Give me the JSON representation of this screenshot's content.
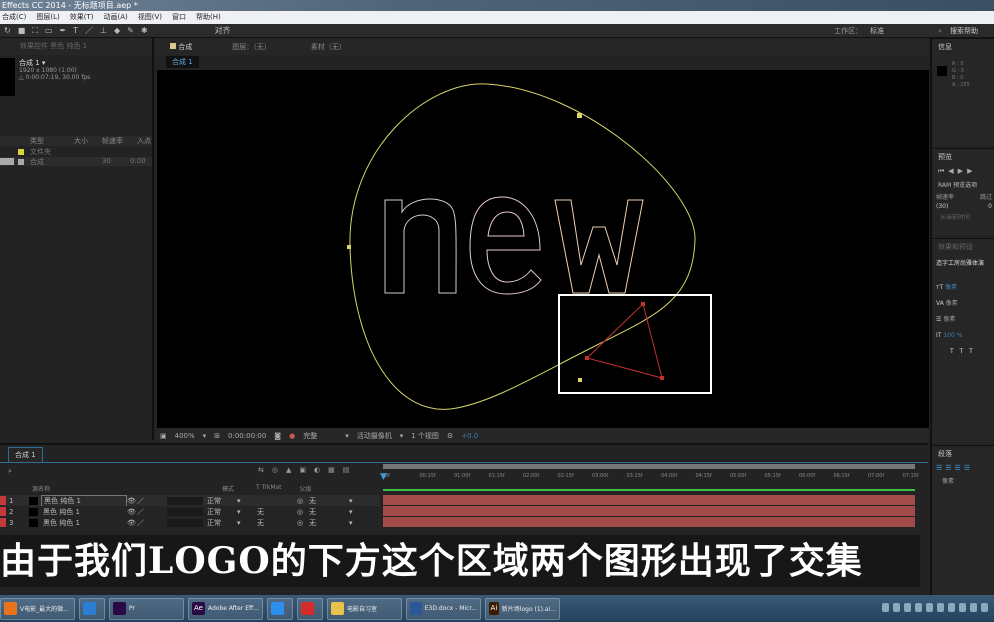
{
  "window": {
    "title": "Effects CC 2014 - 无标题项目.aep *"
  },
  "menu": [
    "合成(C)",
    "图层(L)",
    "效果(T)",
    "动画(A)",
    "视图(V)",
    "窗口",
    "帮助(H)"
  ],
  "toolbar": {
    "snap_label": "对齐",
    "workspace_label": "工作区：",
    "workspace_value": "标准",
    "search_label": "搜索帮助"
  },
  "project": {
    "effects_tab": "效果控件 黑色 纯色 1",
    "comp_name": "合成 1 ▾",
    "comp_size": "1920 x 1080 (1.00)",
    "comp_duration": "△ 0:00:07:19, 30.00 fps",
    "columns": [
      "类型",
      "大小",
      "帧速率",
      "入点"
    ],
    "items": [
      {
        "name": "文件夹",
        "size": "",
        "fps": "",
        "in": ""
      },
      {
        "name": "合成",
        "size": "",
        "fps": "30",
        "in": "0:00"
      }
    ]
  },
  "viewer": {
    "tab": "合成",
    "tab_highlight": "合成 1",
    "layer_label": "图层：（无）",
    "footage_label": "素材（无）",
    "breadcrumb": "合成 1",
    "zoom": "400%",
    "timecode": "0:00:00:00",
    "resolution": "完整",
    "camera": "活动摄像机",
    "views": "1 个视图",
    "exposure": "+0.0"
  },
  "info": {
    "tab": "信息",
    "r": "R : 0",
    "g": "G : 0",
    "b": "B : 0",
    "a": "A : 255"
  },
  "preview": {
    "tab": "预览",
    "ram_options": "RAM 预览选项",
    "fps_label": "帧速率",
    "skip_label": "跳过",
    "fps_value": "(30)",
    "skip_value": "0",
    "from_current": "从当前时间"
  },
  "character": {
    "tab": "效果和预设",
    "font": "造字工房尚雅体演",
    "unit1": "像素",
    "unit2": "像素",
    "unit3": "像素",
    "scale": "100 %"
  },
  "paragraph": {
    "tab": "段落",
    "unit": "像素"
  },
  "timeline": {
    "tab": "合成 1",
    "source_col": "源名称",
    "mode_col": "模式",
    "trkmat_col": "T TrkMat",
    "parent_col": "父级",
    "ruler": [
      "0f",
      "00:15f",
      "01:00f",
      "01:15f",
      "02:00f",
      "02:15f",
      "03:00f",
      "03:15f",
      "04:00f",
      "04:15f",
      "05:00f",
      "05:15f",
      "06:00f",
      "06:15f",
      "07:00f",
      "07:15f"
    ],
    "layers": [
      {
        "num": "1",
        "name": "黑色 纯色 1",
        "mode": "正常",
        "trkmat": "",
        "parent": "无"
      },
      {
        "num": "2",
        "name": "黑色 纯色 1",
        "mode": "正常",
        "trkmat": "无",
        "parent": "无"
      },
      {
        "num": "3",
        "name": "黑色 纯色 1",
        "mode": "正常",
        "trkmat": "无",
        "parent": "无"
      }
    ]
  },
  "subtitle": "由于我们LOGO的下方这个区域两个图形出现了交集",
  "taskbar": [
    {
      "label": "V电影_最大的微...",
      "color": "#e8731c"
    },
    {
      "label": "",
      "color": "#2a7fd4"
    },
    {
      "label": "Pr",
      "color": "#2a0a45"
    },
    {
      "label": "Adobe After Eff...",
      "color": "#2a0a45",
      "glyph": "Ae"
    },
    {
      "label": "",
      "color": "#2c8ff0"
    },
    {
      "label": "",
      "color": "#d62b2b"
    },
    {
      "label": "电影自习室",
      "color": "#e8c24a"
    },
    {
      "label": "E3D.docx - Micr...",
      "color": "#2b5797"
    },
    {
      "label": "新片场logo (1).ai...",
      "color": "#3b1d00",
      "glyph": "Ai"
    }
  ],
  "colors": {
    "shape_path": "#d8d46a",
    "selection_box": "#ffffff",
    "triangle": "#c03030",
    "layer_bar": "#a24b4b",
    "accent": "#3d9bd6"
  }
}
